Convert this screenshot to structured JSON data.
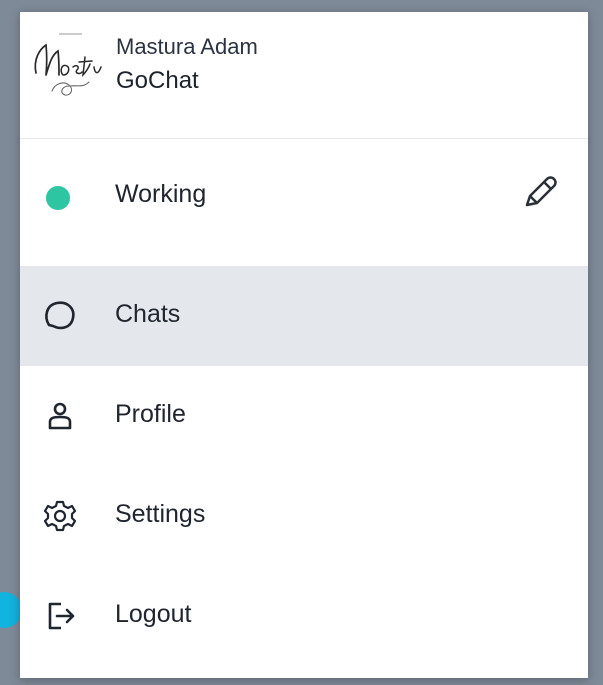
{
  "user": {
    "name": "Mastura Adam",
    "app": "GoChat",
    "logo_text": "Nastura"
  },
  "status": {
    "label": "Working",
    "color": "#2dc5a2",
    "edit_icon": "pencil-icon"
  },
  "menu": [
    {
      "label": "Chats",
      "icon": "chat-bubble-icon",
      "active": true
    },
    {
      "label": "Profile",
      "icon": "user-icon",
      "active": false
    },
    {
      "label": "Settings",
      "icon": "gear-icon",
      "active": false
    },
    {
      "label": "Logout",
      "icon": "logout-icon",
      "active": false
    }
  ],
  "colors": {
    "active_background": "#e4e7ec",
    "marker": "#11b3df"
  }
}
